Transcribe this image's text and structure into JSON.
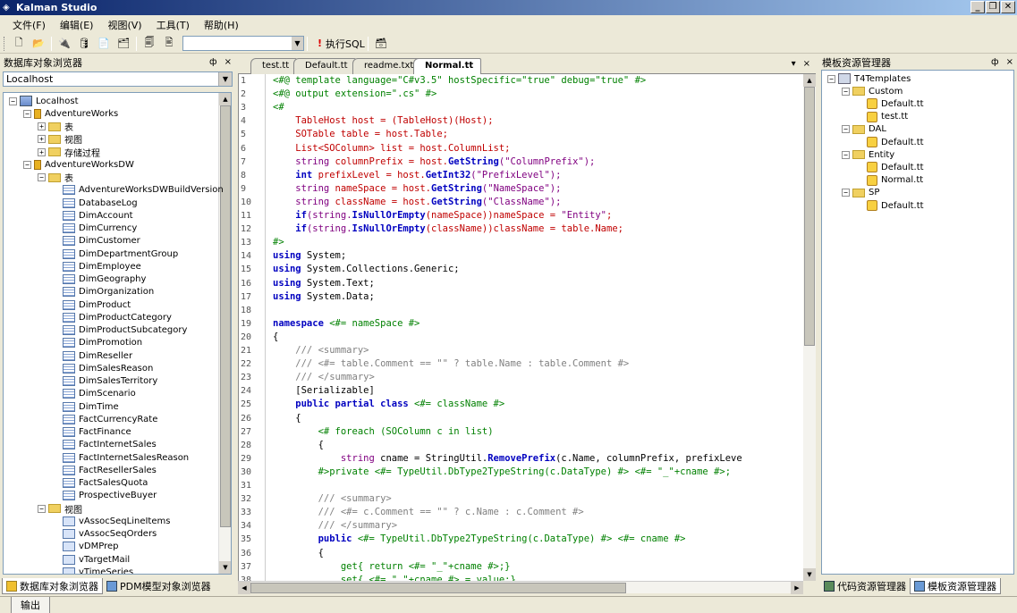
{
  "window": {
    "title": "Kalman Studio"
  },
  "menu": [
    "文件(F)",
    "编辑(E)",
    "视图(V)",
    "工具(T)",
    "帮助(H)"
  ],
  "toolbar": {
    "exec_label": "执行SQL",
    "combo_value": ""
  },
  "left_panel": {
    "title": "数据库对象浏览器",
    "pin": "ф",
    "close": "×",
    "server_combo": "Localhost",
    "tree": [
      {
        "label": "Localhost",
        "level": 0,
        "icon": "server-icon",
        "expander": "−"
      },
      {
        "label": "AdventureWorks",
        "level": 1,
        "icon": "database-icon",
        "expander": "−"
      },
      {
        "label": "表",
        "level": 2,
        "icon": "folder-icon",
        "expander": "+"
      },
      {
        "label": "视图",
        "level": 2,
        "icon": "folder-icon",
        "expander": "+"
      },
      {
        "label": "存储过程",
        "level": 2,
        "icon": "folder-icon",
        "expander": "+"
      },
      {
        "label": "AdventureWorksDW",
        "level": 1,
        "icon": "database-icon",
        "expander": "−"
      },
      {
        "label": "表",
        "level": 2,
        "icon": "folder-icon",
        "expander": "−"
      },
      {
        "label": "AdventureWorksDWBuildVersion",
        "level": 3,
        "icon": "table-icon"
      },
      {
        "label": "DatabaseLog",
        "level": 3,
        "icon": "table-icon"
      },
      {
        "label": "DimAccount",
        "level": 3,
        "icon": "table-icon"
      },
      {
        "label": "DimCurrency",
        "level": 3,
        "icon": "table-icon"
      },
      {
        "label": "DimCustomer",
        "level": 3,
        "icon": "table-icon"
      },
      {
        "label": "DimDepartmentGroup",
        "level": 3,
        "icon": "table-icon"
      },
      {
        "label": "DimEmployee",
        "level": 3,
        "icon": "table-icon"
      },
      {
        "label": "DimGeography",
        "level": 3,
        "icon": "table-icon"
      },
      {
        "label": "DimOrganization",
        "level": 3,
        "icon": "table-icon"
      },
      {
        "label": "DimProduct",
        "level": 3,
        "icon": "table-icon"
      },
      {
        "label": "DimProductCategory",
        "level": 3,
        "icon": "table-icon"
      },
      {
        "label": "DimProductSubcategory",
        "level": 3,
        "icon": "table-icon"
      },
      {
        "label": "DimPromotion",
        "level": 3,
        "icon": "table-icon"
      },
      {
        "label": "DimReseller",
        "level": 3,
        "icon": "table-icon"
      },
      {
        "label": "DimSalesReason",
        "level": 3,
        "icon": "table-icon"
      },
      {
        "label": "DimSalesTerritory",
        "level": 3,
        "icon": "table-icon"
      },
      {
        "label": "DimScenario",
        "level": 3,
        "icon": "table-icon"
      },
      {
        "label": "DimTime",
        "level": 3,
        "icon": "table-icon"
      },
      {
        "label": "FactCurrencyRate",
        "level": 3,
        "icon": "table-icon"
      },
      {
        "label": "FactFinance",
        "level": 3,
        "icon": "table-icon"
      },
      {
        "label": "FactInternetSales",
        "level": 3,
        "icon": "table-icon"
      },
      {
        "label": "FactInternetSalesReason",
        "level": 3,
        "icon": "table-icon"
      },
      {
        "label": "FactResellerSales",
        "level": 3,
        "icon": "table-icon"
      },
      {
        "label": "FactSalesQuota",
        "level": 3,
        "icon": "table-icon"
      },
      {
        "label": "ProspectiveBuyer",
        "level": 3,
        "icon": "table-icon"
      },
      {
        "label": "视图",
        "level": 2,
        "icon": "folder-icon",
        "expander": "−"
      },
      {
        "label": "vAssocSeqLineItems",
        "level": 3,
        "icon": "view-icon"
      },
      {
        "label": "vAssocSeqOrders",
        "level": 3,
        "icon": "view-icon"
      },
      {
        "label": "vDMPrep",
        "level": 3,
        "icon": "view-icon"
      },
      {
        "label": "vTargetMail",
        "level": 3,
        "icon": "view-icon"
      },
      {
        "label": "vTimeSeries",
        "level": 3,
        "icon": "view-icon"
      }
    ],
    "tabs": [
      {
        "label": "数据库对象浏览器",
        "active": true
      },
      {
        "label": "PDM模型对象浏览器",
        "active": false
      }
    ]
  },
  "editor": {
    "tabs": [
      {
        "label": "test.tt",
        "active": false
      },
      {
        "label": "Default.tt",
        "active": false
      },
      {
        "label": "readme.txt",
        "active": false
      },
      {
        "label": "Normal.tt",
        "active": true
      }
    ],
    "tab_dropdown": "▾",
    "tab_close": "×",
    "lines": [
      [
        [
          "<#@ template language=\"C#v3.5\" hostSpecific=\"true\" debug=\"true\" #>",
          "dir"
        ]
      ],
      [
        [
          "<#@ output extension=\".cs\" #>",
          "dir"
        ]
      ],
      [
        [
          "<#",
          "dir"
        ]
      ],
      [
        [
          "    TableHost host = (TableHost)(Host);",
          "red"
        ]
      ],
      [
        [
          "    SOTable table = host.Table;",
          "red"
        ]
      ],
      [
        [
          "    List<SOColumn> list = host.ColumnList;",
          "red"
        ]
      ],
      [
        [
          "    string",
          "str"
        ],
        [
          " columnPrefix = host.",
          "red"
        ],
        [
          "GetString",
          "k"
        ],
        [
          "(\"ColumnPrefix\");",
          "str"
        ]
      ],
      [
        [
          "    int",
          "k"
        ],
        [
          " prefixLevel = host.",
          "red"
        ],
        [
          "GetInt32",
          "k"
        ],
        [
          "(\"PrefixLevel\");",
          "str"
        ]
      ],
      [
        [
          "    string",
          "str"
        ],
        [
          " nameSpace = host.",
          "red"
        ],
        [
          "GetString",
          "k"
        ],
        [
          "(\"NameSpace\");",
          "str"
        ]
      ],
      [
        [
          "    string",
          "str"
        ],
        [
          " className = host.",
          "red"
        ],
        [
          "GetString",
          "k"
        ],
        [
          "(\"ClassName\");",
          "str"
        ]
      ],
      [
        [
          "    if",
          "k"
        ],
        [
          "(string.",
          "str"
        ],
        [
          "IsNullOrEmpty",
          "k"
        ],
        [
          "(nameSpace))nameSpace = ",
          "red"
        ],
        [
          "\"Entity\"",
          "str"
        ],
        [
          ";",
          "red"
        ]
      ],
      [
        [
          "    if",
          "k"
        ],
        [
          "(string.",
          "str"
        ],
        [
          "IsNullOrEmpty",
          "k"
        ],
        [
          "(className))className = table.Name;",
          "red"
        ]
      ],
      [
        [
          "#>",
          "dir"
        ]
      ],
      [
        [
          "using",
          "k"
        ],
        [
          " System;",
          "typ"
        ]
      ],
      [
        [
          "using",
          "k"
        ],
        [
          " System.Collections.Generic;",
          "typ"
        ]
      ],
      [
        [
          "using",
          "k"
        ],
        [
          " System.Text;",
          "typ"
        ]
      ],
      [
        [
          "using",
          "k"
        ],
        [
          " System.Data;",
          "typ"
        ]
      ],
      [
        [
          "",
          "typ"
        ]
      ],
      [
        [
          "namespace",
          "k"
        ],
        [
          " <#= nameSpace #>",
          "dir"
        ]
      ],
      [
        [
          "{",
          "typ"
        ]
      ],
      [
        [
          "    /// ",
          "cmt"
        ],
        [
          "<summary>",
          "cmt"
        ]
      ],
      [
        [
          "    /// <#= table.Comment == \"\" ? table.Name : table.Comment #>",
          "cmt"
        ]
      ],
      [
        [
          "    /// ",
          "cmt"
        ],
        [
          "</summary>",
          "cmt"
        ]
      ],
      [
        [
          "    [Serializable]",
          "typ"
        ]
      ],
      [
        [
          "    public partial class",
          "k"
        ],
        [
          " <#= className #>",
          "dir"
        ]
      ],
      [
        [
          "    {",
          "typ"
        ]
      ],
      [
        [
          "        <# foreach (SOColumn c in list)",
          "dir"
        ]
      ],
      [
        [
          "        {",
          "typ"
        ]
      ],
      [
        [
          "            string",
          "str"
        ],
        [
          " cname = StringUtil.",
          "typ"
        ],
        [
          "RemovePrefix",
          "k"
        ],
        [
          "(c.Name, columnPrefix, prefixLeve",
          "typ"
        ]
      ],
      [
        [
          "        #>private <#= TypeUtil.DbType2TypeString(c.DataType) #> <#= \"_\"+cname #>;",
          "dir"
        ]
      ],
      [
        [
          "",
          "typ"
        ]
      ],
      [
        [
          "        /// ",
          "cmt"
        ],
        [
          "<summary>",
          "cmt"
        ]
      ],
      [
        [
          "        /// <#= c.Comment == \"\" ? c.Name : c.Comment #>",
          "cmt"
        ]
      ],
      [
        [
          "        /// ",
          "cmt"
        ],
        [
          "</summary>",
          "cmt"
        ]
      ],
      [
        [
          "        public",
          "k"
        ],
        [
          " <#= TypeUtil.DbType2TypeString(c.DataType) #> <#= cname #>",
          "dir"
        ]
      ],
      [
        [
          "        {",
          "typ"
        ]
      ],
      [
        [
          "            get{ return <#= \"_\"+cname #>;}",
          "dir"
        ]
      ],
      [
        [
          "            set{ <#= \"_\"+cname #> = value;}",
          "dir"
        ]
      ]
    ]
  },
  "right_panel": {
    "title": "模板资源管理器",
    "pin": "ф",
    "close": "×",
    "tree": [
      {
        "label": "T4Templates",
        "level": 0,
        "icon": "template-root-icon",
        "expander": "−"
      },
      {
        "label": "Custom",
        "level": 1,
        "icon": "folder-icon",
        "expander": "−"
      },
      {
        "label": "Default.tt",
        "level": 2,
        "icon": "template-file-icon"
      },
      {
        "label": "test.tt",
        "level": 2,
        "icon": "template-file-icon"
      },
      {
        "label": "DAL",
        "level": 1,
        "icon": "folder-icon",
        "expander": "−"
      },
      {
        "label": "Default.tt",
        "level": 2,
        "icon": "template-file-icon"
      },
      {
        "label": "Entity",
        "level": 1,
        "icon": "folder-icon",
        "expander": "−"
      },
      {
        "label": "Default.tt",
        "level": 2,
        "icon": "template-file-icon"
      },
      {
        "label": "Normal.tt",
        "level": 2,
        "icon": "template-file-icon"
      },
      {
        "label": "SP",
        "level": 1,
        "icon": "folder-icon",
        "expander": "−"
      },
      {
        "label": "Default.tt",
        "level": 2,
        "icon": "template-file-icon"
      }
    ],
    "tabs": [
      {
        "label": "代码资源管理器",
        "active": false
      },
      {
        "label": "模板资源管理器",
        "active": true
      }
    ]
  },
  "statusbar": {
    "output_label": "输出"
  }
}
